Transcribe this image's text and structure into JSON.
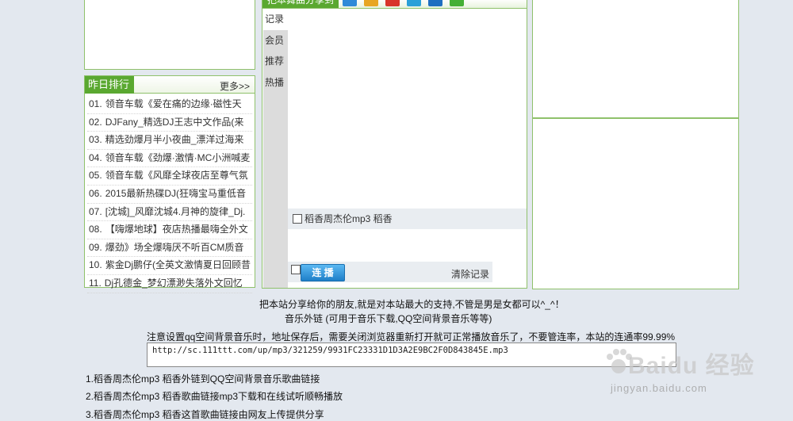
{
  "ranking": {
    "title": "昨日排行",
    "more": "更多>>",
    "items": [
      {
        "num": "01.",
        "text": "领音车载《爱在痛的边缘·磁性天"
      },
      {
        "num": "02.",
        "text": "DJFany_精选DJ王志中文作品(来"
      },
      {
        "num": "03.",
        "text": "精选劲爆月半小夜曲_漂洋过海来"
      },
      {
        "num": "04.",
        "text": "领音车载《劲爆·激情·MC小洲喊麦"
      },
      {
        "num": "05.",
        "text": "领音车载《风靡全球夜店至尊气氛"
      },
      {
        "num": "06.",
        "text": "2015最新热碟DJ(狂嗨宝马重低音"
      },
      {
        "num": "07.",
        "text": "[沈城]_风靡沈城4.月神的旋律_Dj."
      },
      {
        "num": "08.",
        "text": "【嗨爆地球】夜店热播最嗨全外文"
      },
      {
        "num": "09.",
        "text": "爆劲》场全爆嗨厌不听百CM质音"
      },
      {
        "num": "10.",
        "text": "紫金Dj鹏仔(全英文激情夏日回顾昔"
      },
      {
        "num": "11.",
        "text": "Dj孔德金_梦幻漂渺失落外文回忆"
      }
    ]
  },
  "player": {
    "header_title": "把本舞曲分享到",
    "tabs": [
      "记录",
      "会员",
      "推荐",
      "热播"
    ],
    "track_label": "稻香周杰伦mp3 稻香",
    "play_button": "连 播",
    "clear_link": "清除记录",
    "share_icons": [
      {
        "name": "qzone-icon",
        "color": "#2f8ad8"
      },
      {
        "name": "star-icon",
        "color": "#e8a623"
      },
      {
        "name": "weibo-icon",
        "color": "#d8352a"
      },
      {
        "name": "tencent-icon",
        "color": "#2aa0d8"
      },
      {
        "name": "renren-icon",
        "color": "#1f6fc0"
      },
      {
        "name": "wechat-icon",
        "color": "#44b035"
      }
    ]
  },
  "info": {
    "share_text": "把本站分享给你的朋友,就是对本站最大的支持,不管是男是女都可以^_^！",
    "external_link_text": "音乐外链 (可用于音乐下载,QQ空间背景音乐等等)",
    "notice_text": "注意设置qq空间背景音乐时，地址保存后，需要关闭浏览器重新打开就可正常播放音乐了，不要管连率，本站的连通率99.99%",
    "url": "http://sc.111ttt.com/up/mp3/321259/9931FC23331D1D3A2E9BC2F0D843845E.mp3",
    "list": [
      "1.稻香周杰伦mp3 稻香外链到QQ空间背景音乐歌曲链接",
      "2.稻香周杰伦mp3 稻香歌曲链接mp3下载和在线试听顺畅播放",
      "3.稻香周杰伦mp3 稻香这首歌曲链接由网友上传提供分享"
    ]
  },
  "watermark": {
    "main": "Baidu 经验",
    "sub": "jingyan.baidu.com"
  }
}
